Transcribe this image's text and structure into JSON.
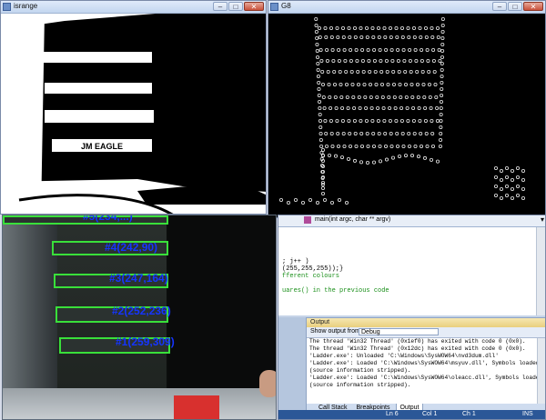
{
  "windows": {
    "threshold": {
      "title": "isrange"
    },
    "edges": {
      "title": "G8"
    }
  },
  "detections": [
    {
      "label": "#4(242,90)"
    },
    {
      "label": "#3(247,164)"
    },
    {
      "label": "#2(252,236)"
    },
    {
      "label": "#1(259,309)"
    },
    {
      "label": "#5(234,...)"
    }
  ],
  "ide": {
    "function_dropdown": "main(int argc, char ** argv)",
    "code_lines": [
      "; j++ )",
      "(255,255,255));}",
      "fferent colours",
      "",
      "uares() in the previous code"
    ],
    "output_panel": {
      "title": "Output",
      "show_output_label": "Show output from:",
      "show_output_value": "Debug",
      "lines": [
        "The thread 'Win32 Thread' (0x1ef0) has exited with code 0 (0x0).",
        "The thread 'Win32 Thread' (0x12dc) has exited with code 0 (0x0).",
        "'Ladder.exe': Unloaded 'C:\\Windows\\SysWOW64\\nvd3dum.dll'",
        "'Ladder.exe': Loaded 'C:\\Windows\\SysWOW64\\msyuv.dll', Symbols loaded",
        "(source information stripped).",
        "'Ladder.exe': Loaded 'C:\\Windows\\SysWOW64\\oleacc.dll', Symbols loaded",
        "(source information stripped)."
      ],
      "tabs": [
        "Call Stack",
        "Breakpoints",
        "Output"
      ]
    },
    "status": {
      "ln": "Ln 6",
      "col": "Col 1",
      "ch": "Ch 1",
      "mode": "INS"
    }
  },
  "colors": {
    "rung_outline": "#39e03a",
    "label_text": "#1535ff"
  },
  "icons": {
    "window": "app-window-icon",
    "minimize": "minimize-icon",
    "maximize": "maximize-icon",
    "close": "close-icon"
  }
}
